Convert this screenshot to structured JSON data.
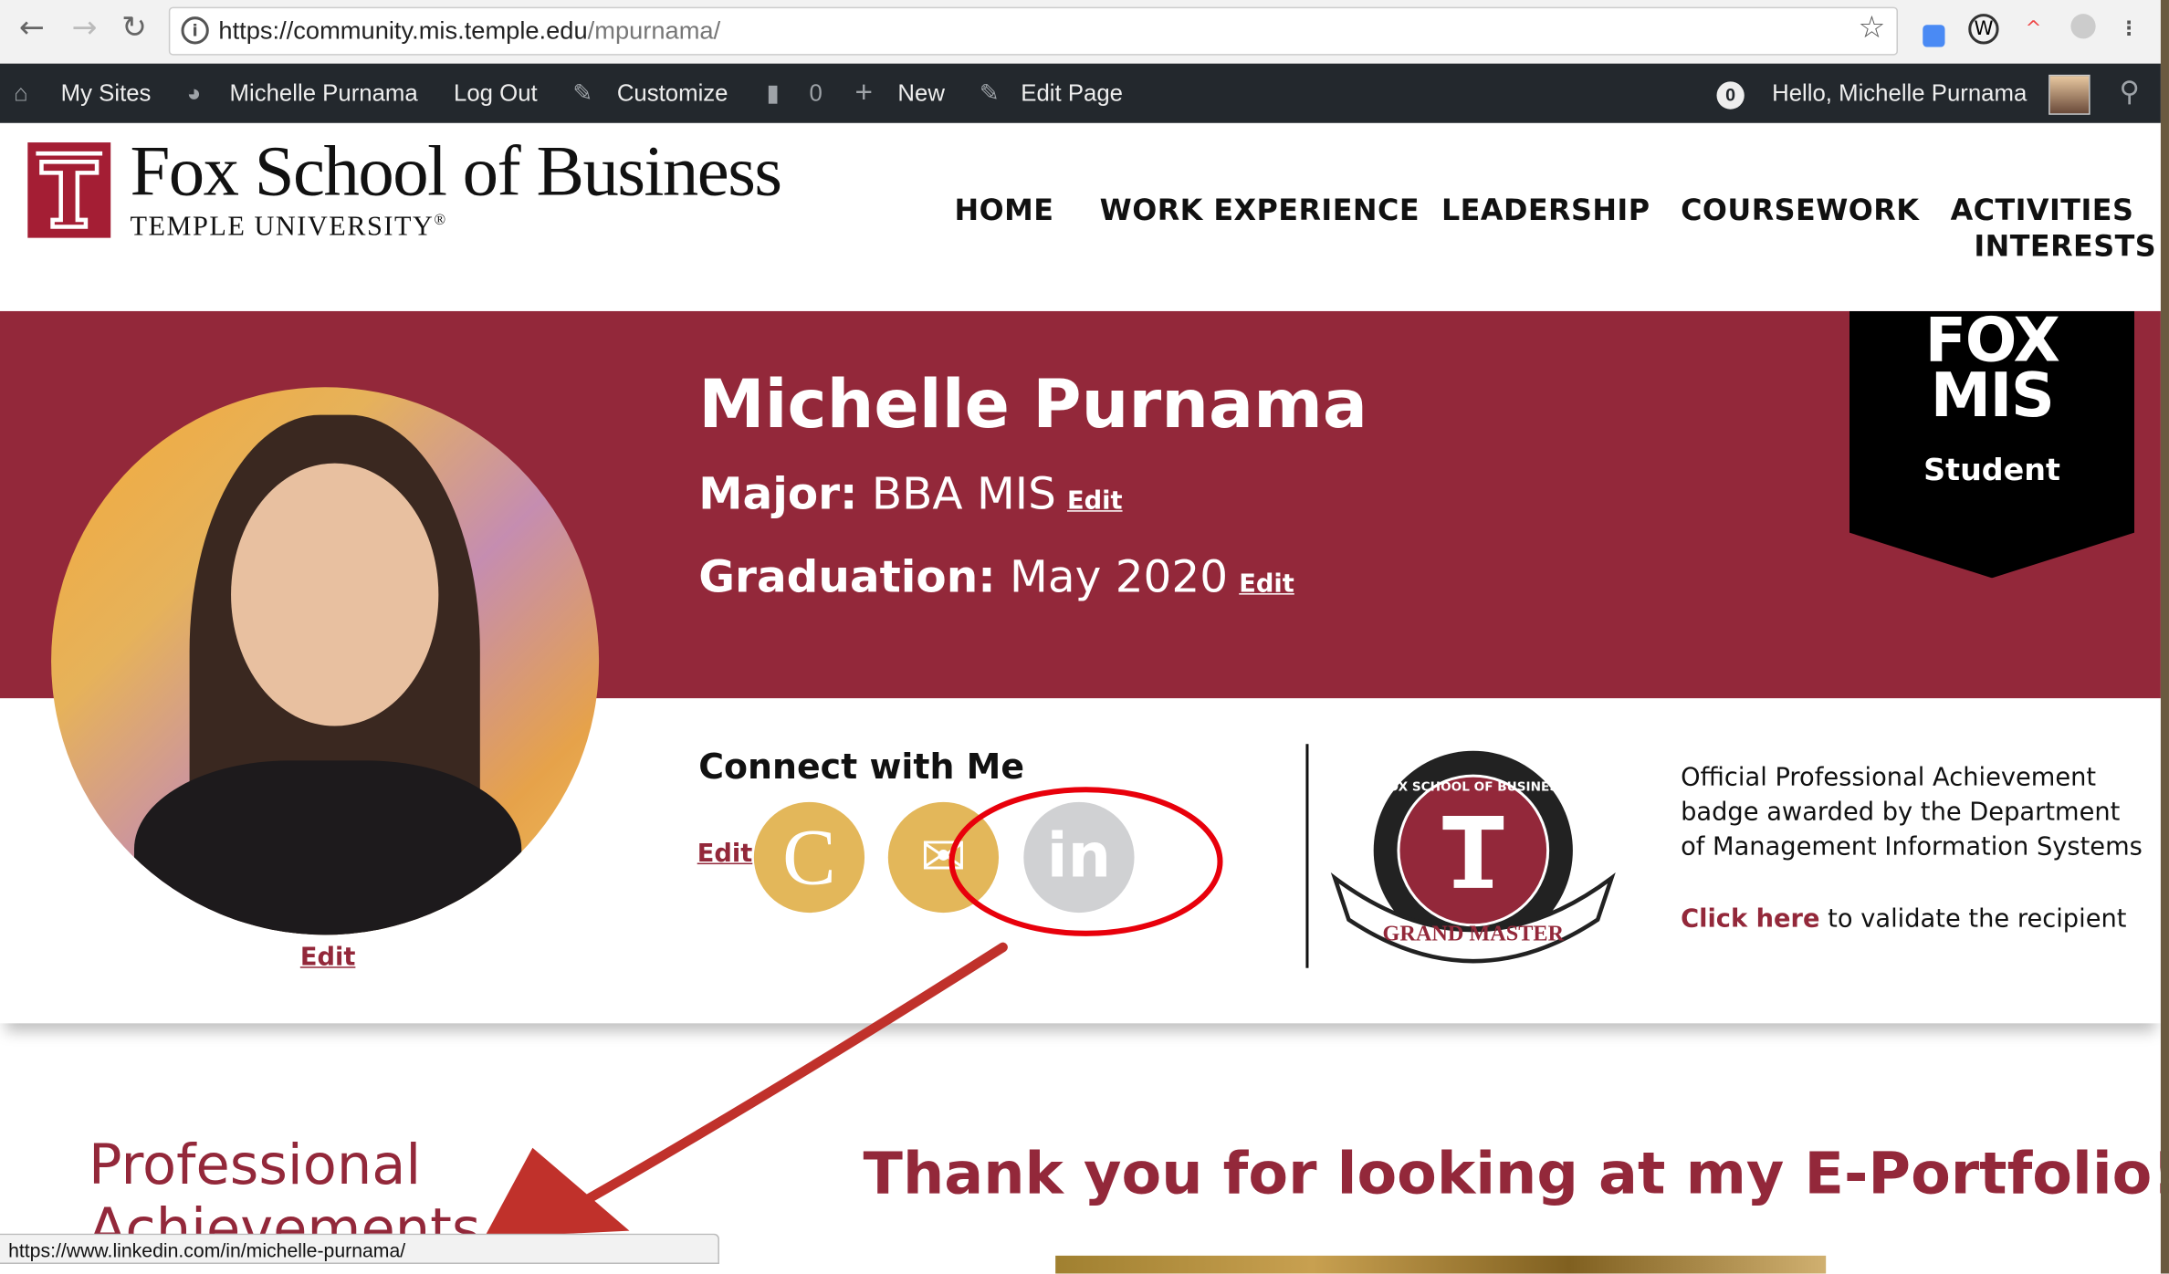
{
  "browser": {
    "url_host": "https://community.mis.temple.edu",
    "url_path": "/mpurnama/",
    "status_url": "https://www.linkedin.com/in/michelle-purnama/"
  },
  "admin_bar": {
    "my_sites": "My Sites",
    "site_name": "Michelle Purnama",
    "log_out": "Log Out",
    "customize": "Customize",
    "comments_count": "0",
    "new": "New",
    "edit_page": "Edit Page",
    "notifications_count": "0",
    "greeting": "Hello, Michelle Purnama"
  },
  "logo": {
    "name": "Fox School of Business",
    "sub": "TEMPLE UNIVERSITY",
    "reg": "®"
  },
  "nav": [
    "HOME",
    "WORK EXPERIENCE",
    "LEADERSHIP",
    "COURSEWORK",
    "ACTIVITIES",
    "INTERESTS"
  ],
  "profile": {
    "name": "Michelle Purnama",
    "major_label": "Major:",
    "major": "BBA MIS",
    "graduation_label": "Graduation:",
    "graduation": "May 2020",
    "edit": "Edit"
  },
  "ribbon": {
    "line1": "FOX",
    "line2": "MIS",
    "role": "Student"
  },
  "connect": {
    "title": "Connect with Me",
    "edit": "Edit",
    "icons": [
      "c-icon",
      "email-icon",
      "linkedin-icon"
    ],
    "colors": {
      "gold": "#e3b75a",
      "gray": "#d0d1d3"
    }
  },
  "badge": {
    "ring_text": "FOX SCHOOL OF BUSINESS",
    "banner_text": "GRAND MASTER",
    "description": "Official Professional Achievement badge awarded by the Department of Management Information Systems",
    "link": "Click here",
    "link_suffix": " to validate the recipient"
  },
  "sections": {
    "professional": "Professional Achievements",
    "thanks": "Thank you for looking at my E-Portfolio!"
  },
  "colors": {
    "maroon": "#93283a",
    "adminbar": "#23282d",
    "annotation_red": "#e8000b"
  }
}
